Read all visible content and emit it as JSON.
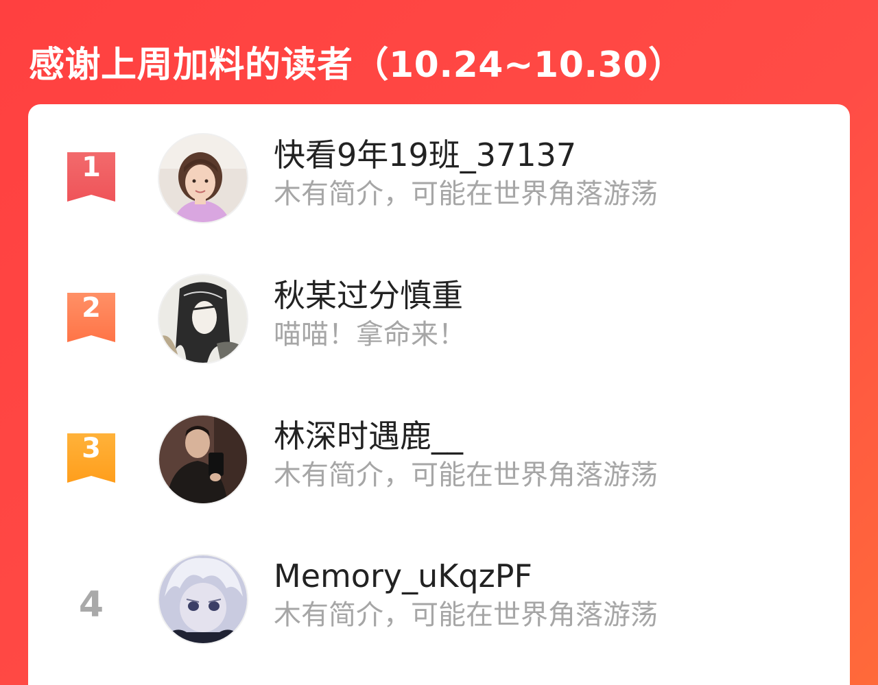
{
  "header": {
    "title": "感谢上周加料的读者（10.24~10.30）"
  },
  "colors": {
    "rank1": "#f55a5e",
    "rank2": "#ff7a50",
    "rank3": "#ffa51f",
    "rank_plain": "#a9a9a9"
  },
  "readers": [
    {
      "rank": "1",
      "name": "快看9年19班_37137",
      "bio": "木有简介，可能在世界角落游荡",
      "avatar": "avatar-girl-pink-shirt"
    },
    {
      "rank": "2",
      "name": "秋某过分慎重",
      "bio": "喵喵！拿命来！",
      "avatar": "avatar-anime-long-hair"
    },
    {
      "rank": "3",
      "name": "林深时遇鹿__",
      "bio": "木有简介，可能在世界角落游荡",
      "avatar": "avatar-man-mirror-selfie"
    },
    {
      "rank": "4",
      "name": "Memory_uKqzPF",
      "bio": "木有简介，可能在世界角落游荡",
      "avatar": "avatar-anime-white-hair"
    }
  ]
}
